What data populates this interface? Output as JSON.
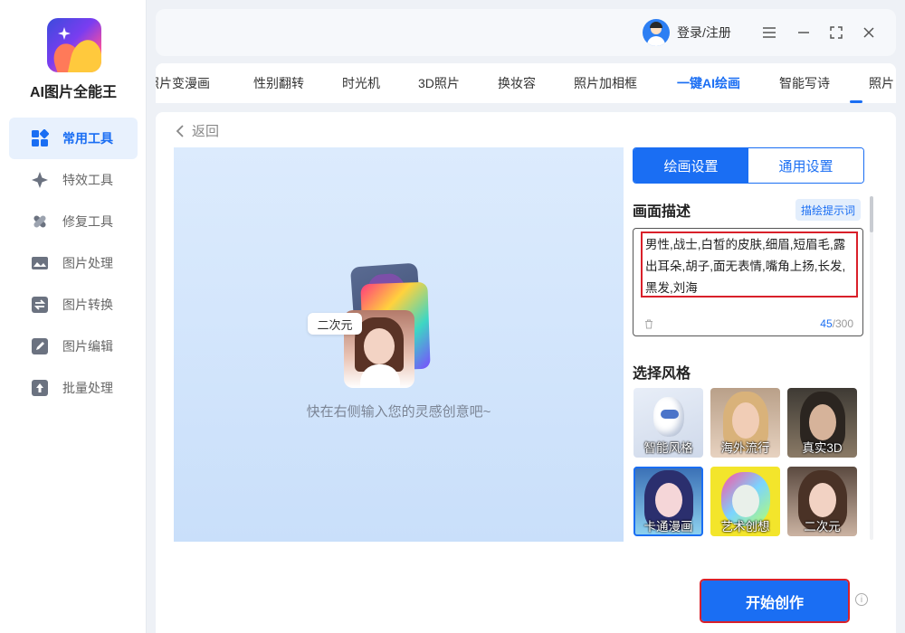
{
  "app": {
    "name": "AI图片全能王"
  },
  "sidebar": {
    "items": [
      {
        "label": "常用工具",
        "icon": "grid-icon",
        "active": true
      },
      {
        "label": "特效工具",
        "icon": "sparkle-icon",
        "active": false
      },
      {
        "label": "修复工具",
        "icon": "bandage-icon",
        "active": false
      },
      {
        "label": "图片处理",
        "icon": "image-icon",
        "active": false
      },
      {
        "label": "图片转换",
        "icon": "convert-icon",
        "active": false
      },
      {
        "label": "图片编辑",
        "icon": "edit-icon",
        "active": false
      },
      {
        "label": "批量处理",
        "icon": "upload-icon",
        "active": false
      }
    ]
  },
  "header": {
    "login_label": "登录/注册"
  },
  "tabs": [
    {
      "label": "照片变漫画"
    },
    {
      "label": "性别翻转"
    },
    {
      "label": "时光机"
    },
    {
      "label": "3D照片"
    },
    {
      "label": "换妆容"
    },
    {
      "label": "照片加相框"
    },
    {
      "label": "一键AI绘画",
      "active": true
    },
    {
      "label": "智能写诗"
    },
    {
      "label": "照片"
    }
  ],
  "main": {
    "back_label": "返回",
    "preview": {
      "chip": "二次元",
      "hint": "快在右侧输入您的灵感创意吧~"
    },
    "panel": {
      "tab_drawing": "绘画设置",
      "tab_general": "通用设置",
      "desc_title": "画面描述",
      "hint_button": "描绘提示词",
      "desc_text": "男性,战士,白皙的皮肤,细眉,短眉毛,露出耳朵,胡子,面无表情,嘴角上扬,长发,黑发,刘海",
      "count_current": "45",
      "count_max": "/300",
      "style_title": "选择风格",
      "styles": [
        {
          "label": "智能风格"
        },
        {
          "label": "海外流行"
        },
        {
          "label": "真实3D"
        },
        {
          "label": "卡通漫画",
          "selected": true
        },
        {
          "label": "艺术创想"
        },
        {
          "label": "二次元"
        }
      ]
    },
    "start_button": "开始创作"
  },
  "colors": {
    "accent": "#1a6ef3",
    "highlight": "#d9202a"
  }
}
